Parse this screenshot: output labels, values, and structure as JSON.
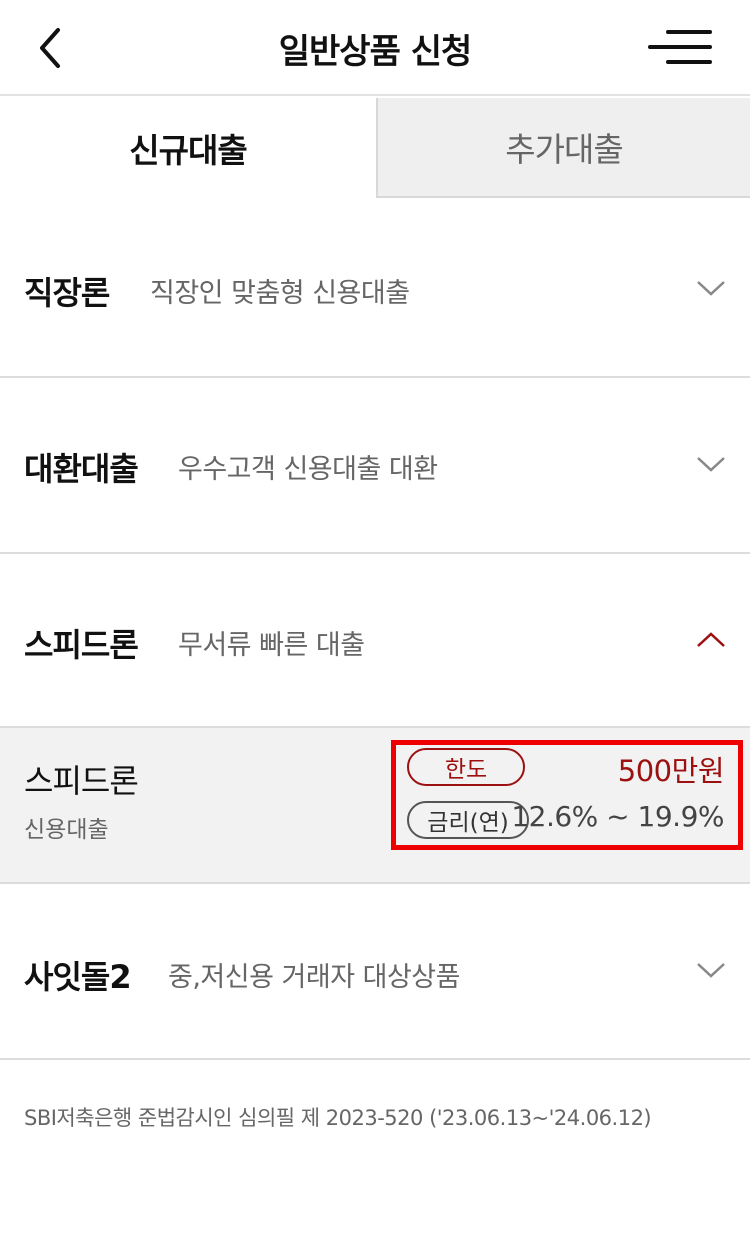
{
  "header": {
    "title": "일반상품 신청",
    "back_icon": "chevron-left-icon",
    "menu_icon": "hamburger-menu-icon"
  },
  "tabs": [
    {
      "label": "신규대출",
      "active": true
    },
    {
      "label": "추가대출",
      "active": false
    }
  ],
  "products": [
    {
      "name": "직장론",
      "description": "직장인 맞춤형 신용대출",
      "expanded": false
    },
    {
      "name": "대환대출",
      "description": "우수고객 신용대출 대환",
      "expanded": false
    },
    {
      "name": "스피드론",
      "description": "무서류 빠른 대출",
      "expanded": true
    },
    {
      "name": "사잇돌2",
      "description": "중,저신용 거래자 대상상품",
      "expanded": false
    }
  ],
  "expanded_detail": {
    "name": "스피드론",
    "type": "신용대출",
    "limit_label": "한도",
    "limit_value": "500만원",
    "rate_label": "금리(연)",
    "rate_value": "12.6% ~ 19.9%"
  },
  "footer": {
    "note": "SBI저축은행 준법감시인 심의필 제 2023-520 ('23.06.13~'24.06.12)"
  },
  "colors": {
    "accent": "#9c1010",
    "highlight": "#ee0000",
    "tab_inactive_bg": "#efefef",
    "panel_bg": "#f2f2f2"
  }
}
